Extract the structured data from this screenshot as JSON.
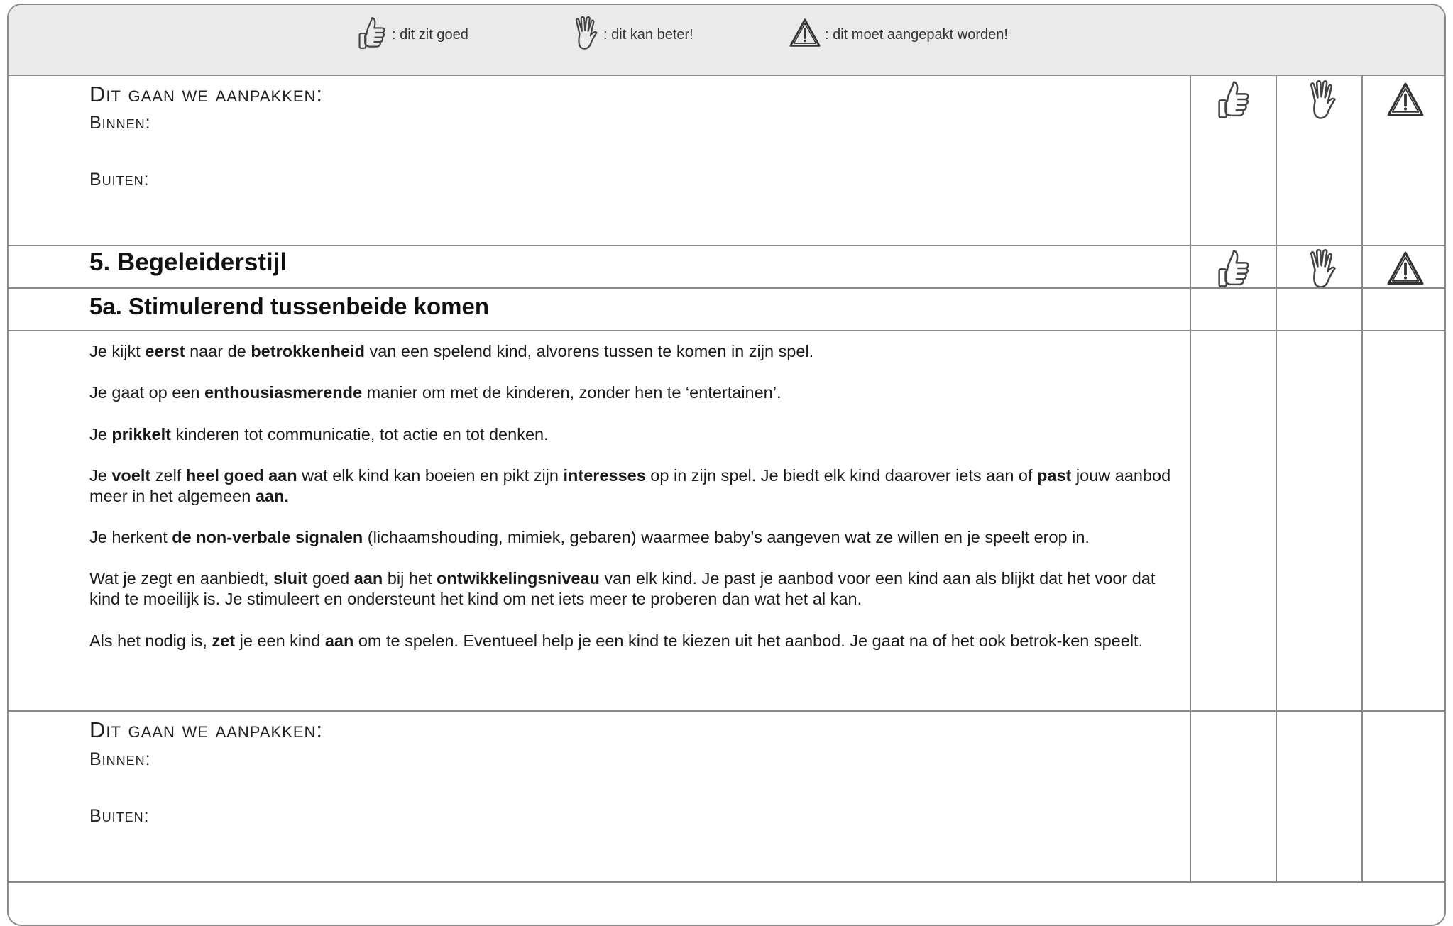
{
  "legend": {
    "good": {
      "icon": "thumbs-up-icon",
      "label": ": dit zit goed"
    },
    "better": {
      "icon": "raised-hand-icon",
      "label": ": dit kan beter!"
    },
    "tackle": {
      "icon": "warning-triangle-icon",
      "label": ": dit moet aangepakt worden!"
    }
  },
  "block1": {
    "heading": "Dit gaan we aanpakken:",
    "inside": "Binnen:",
    "outside": "Buiten:"
  },
  "section5": {
    "title": "5. Begeleiderstijl"
  },
  "section5a": {
    "title": "5a. Stimulerend tussenbeide komen",
    "items": [
      [
        {
          "t": "Je kijkt "
        },
        {
          "t": "eerst",
          "b": true
        },
        {
          "t": " naar de "
        },
        {
          "t": "betrokkenheid",
          "b": true
        },
        {
          "t": " van een spelend kind, alvorens tussen te komen in zijn spel."
        }
      ],
      [
        {
          "t": "Je gaat op een "
        },
        {
          "t": "enthousiasmerende",
          "b": true
        },
        {
          "t": " manier om met de kinderen, zonder hen te ‘entertainen’."
        }
      ],
      [
        {
          "t": "Je "
        },
        {
          "t": "prikkelt",
          "b": true
        },
        {
          "t": " kinderen tot communicatie, tot actie en tot denken."
        }
      ],
      [
        {
          "t": "Je "
        },
        {
          "t": "voelt",
          "b": true
        },
        {
          "t": " zelf "
        },
        {
          "t": "heel goed aan",
          "b": true
        },
        {
          "t": " wat elk kind kan boeien en pikt zijn "
        },
        {
          "t": "interesses",
          "b": true
        },
        {
          "t": " op in zijn spel. Je biedt elk kind daarover iets aan of "
        },
        {
          "t": "past",
          "b": true
        },
        {
          "t": " jouw aanbod meer in het algemeen "
        },
        {
          "t": "aan.",
          "b": true
        }
      ],
      [
        {
          "t": "Je herkent "
        },
        {
          "t": "de non-verbale signalen",
          "b": true
        },
        {
          "t": " (lichaamshouding, mimiek, gebaren) waarmee baby’s aangeven wat ze willen en je speelt erop in."
        }
      ],
      [
        {
          "t": "Wat je zegt en aanbiedt, "
        },
        {
          "t": "sluit",
          "b": true
        },
        {
          "t": " goed "
        },
        {
          "t": "aan",
          "b": true
        },
        {
          "t": " bij het "
        },
        {
          "t": "ontwikkelingsniveau",
          "b": true
        },
        {
          "t": " van elk kind. Je past je aanbod voor een kind aan als blijkt dat het voor dat kind te moeilijk is. Je stimuleert en ondersteunt het kind om net iets meer te proberen dan wat het al kan."
        }
      ],
      [
        {
          "t": "Als het nodig is, "
        },
        {
          "t": "zet",
          "b": true
        },
        {
          "t": " je een kind "
        },
        {
          "t": "aan",
          "b": true
        },
        {
          "t": " om te spelen. Eventueel help je een kind te kiezen uit het aanbod. Je gaat na of het ook betrok-ken speelt."
        }
      ]
    ]
  },
  "block2": {
    "heading": "Dit gaan we aanpakken:",
    "inside": "Binnen:",
    "outside": "Buiten:"
  }
}
